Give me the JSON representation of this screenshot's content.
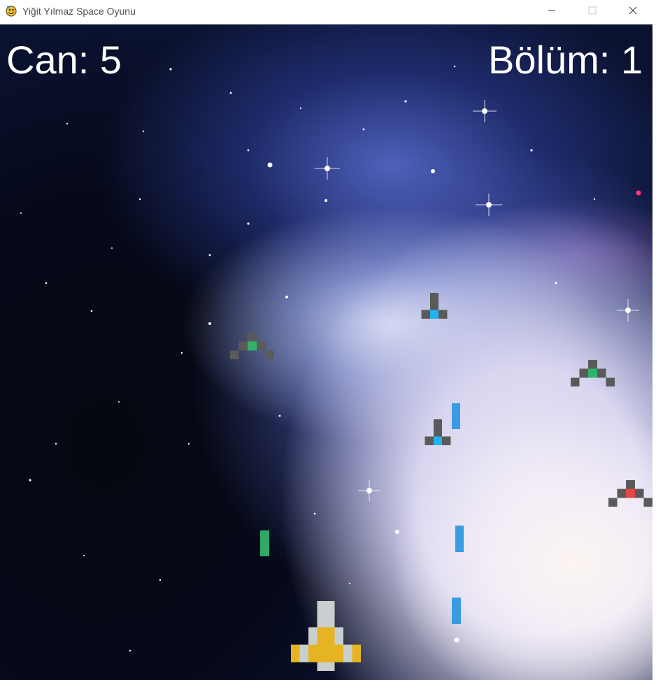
{
  "window": {
    "title": "Yiğit Yılmaz Space Oyunu",
    "icon": "pygame-snake-icon",
    "controls": [
      "minimize-icon",
      "maximize-icon",
      "close-icon"
    ]
  },
  "hud": {
    "lives_text": "Can: 5",
    "level_text": "Bölüm: 1"
  },
  "colors": {
    "hud_text": "#ffffff",
    "player_body": "#c9cfcf",
    "player_accent": "#e6b422",
    "enemy_body": "#5a5a5a",
    "enemy_green": "#2fb36b",
    "enemy_blue": "#1eb4f0",
    "enemy_red": "#e04848",
    "laser_blue": "#3a9be0",
    "laser_green": "#2faa66"
  },
  "entities": {
    "player": {
      "type": "player-ship"
    },
    "enemies": [
      {
        "type": "green-enemy-ship"
      },
      {
        "type": "blue-enemy-ship"
      },
      {
        "type": "green-enemy-ship"
      },
      {
        "type": "blue-enemy-ship"
      },
      {
        "type": "red-enemy-ship"
      }
    ],
    "lasers": [
      {
        "type": "blue-laser"
      },
      {
        "type": "blue-laser"
      },
      {
        "type": "blue-laser"
      },
      {
        "type": "green-laser"
      }
    ]
  }
}
